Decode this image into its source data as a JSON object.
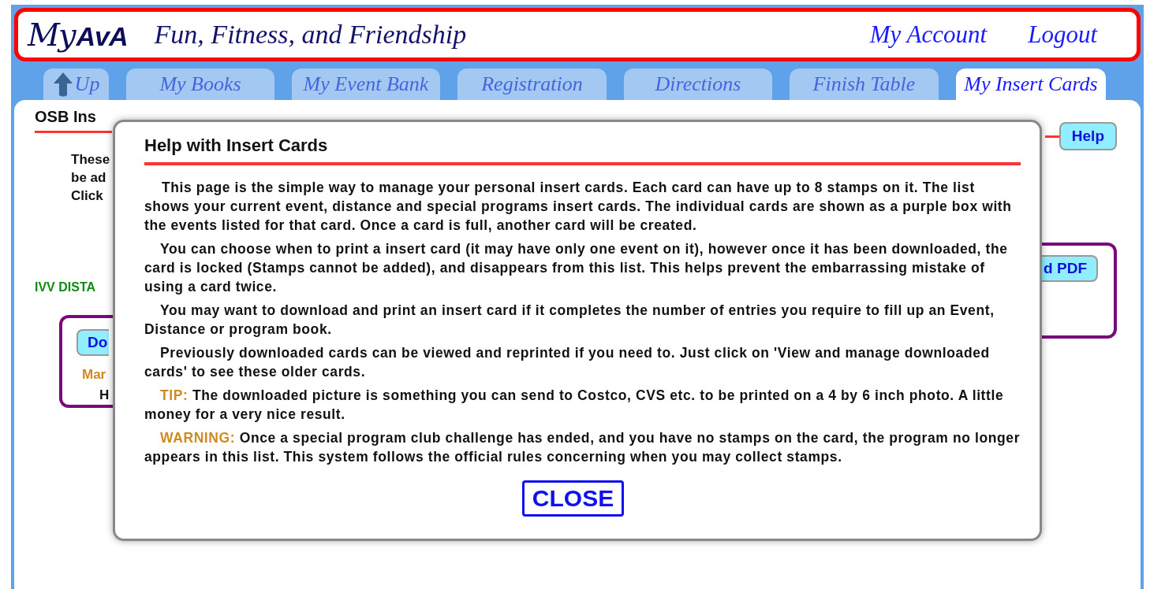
{
  "header": {
    "logo": {
      "script": "My",
      "mark": "AvA"
    },
    "tagline": "Fun, Fitness, and Friendship",
    "links": [
      "My Account",
      "Logout"
    ]
  },
  "tabs": [
    {
      "label": "Up",
      "kind": "up",
      "selected": false
    },
    {
      "label": "My Books",
      "kind": "plain",
      "selected": false
    },
    {
      "label": "My Event Bank",
      "kind": "plain",
      "selected": false
    },
    {
      "label": "Registration",
      "kind": "plain",
      "selected": false
    },
    {
      "label": "Directions",
      "kind": "plain",
      "selected": false
    },
    {
      "label": "Finish Table",
      "kind": "plain",
      "selected": false
    },
    {
      "label": "My Insert Cards",
      "kind": "plain",
      "selected": true
    }
  ],
  "page": {
    "title": "OSB Ins",
    "help_button": "Help",
    "intro_lines": [
      "These",
      "be ad",
      "Click"
    ],
    "section_label": "IVV DISTA",
    "card": {
      "button": "Do",
      "name": "Mar",
      "line": "H"
    },
    "right_card": {
      "button": "d PDF"
    }
  },
  "dialog": {
    "title": "Help with Insert Cards",
    "paragraphs": [
      {
        "text": "This page is the simple way to manage your personal insert cards. Each card can have up to 8 stamps on it. The list shows your current event, distance and special programs insert cards. The individual cards are shown as a purple box with the events listed for that card. Once a card is full, another card will be created."
      },
      {
        "text": "You can choose when to print a insert card (it may have only one event on it), however once it has been downloaded, the card is locked (Stamps cannot be added), and disappears from this list. This helps prevent the embarrassing mistake of using a card twice."
      },
      {
        "text": "You may want to download and print an insert card if it completes the number of entries you require to fill up an Event, Distance or program book."
      },
      {
        "text": "Previously downloaded cards can be viewed and reprinted if you need to. Just click on 'View and manage downloaded cards' to see these older cards."
      },
      {
        "lead": "TIP:",
        "text": "The downloaded picture is something you can send to Costco, CVS etc. to be printed on a 4 by 6 inch photo. A little money for a very nice result."
      },
      {
        "lead": "WARNING:",
        "text": "Once a special program club challenge has ended, and you have no stamps on the card, the program no longer appears in this list. This system follows the official rules concerning when you may collect stamps."
      }
    ],
    "close_button": "CLOSE"
  }
}
